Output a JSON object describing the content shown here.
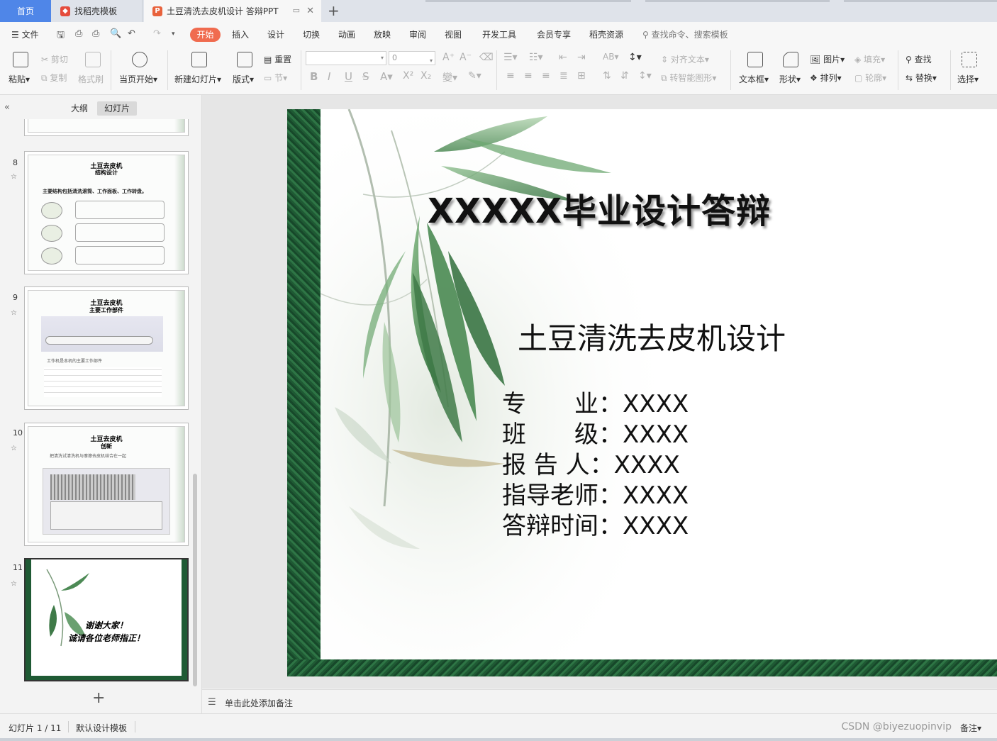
{
  "tabs": {
    "home": "首页",
    "template_tab": "找稻壳模板",
    "doc_tab": "土豆清洗去皮机设计 答辩PPT"
  },
  "menu": {
    "file": "文件",
    "items": [
      "开始",
      "插入",
      "设计",
      "切换",
      "动画",
      "放映",
      "审阅",
      "视图",
      "开发工具",
      "会员专享",
      "稻壳资源"
    ],
    "search": "查找命令、搜索模板"
  },
  "ribbon": {
    "paste": "粘贴",
    "cut": "剪切",
    "copy": "复制",
    "format_painter": "格式刷",
    "from_start": "当页开始",
    "new_slide": "新建幻灯片",
    "layout": "版式",
    "reset": "重置",
    "section": "节",
    "font_size": "0",
    "align_text": "对齐文本",
    "smart_art": "转智能图形",
    "text_box": "文本框",
    "shape": "形状",
    "picture": "图片",
    "arrange": "排列",
    "fill": "填充",
    "outline": "轮廓",
    "find": "查找",
    "replace": "替换",
    "select": "选择"
  },
  "left_pane": {
    "tab_outline": "大纲",
    "tab_slides": "幻灯片",
    "slides": [
      {
        "num": "8",
        "title": "土豆去皮机",
        "sub": "结构设计",
        "text": "主要结构包括清洗滚筒、工作面板、工作转盘。"
      },
      {
        "num": "9",
        "title": "土豆去皮机",
        "sub": "主要工作部件",
        "text": "工作机是本机的主要工作部件"
      },
      {
        "num": "10",
        "title": "土豆去皮机",
        "sub": "创新",
        "text": "把清洗试清洗机与摩擦去皮机结合在一起"
      },
      {
        "num": "11",
        "title": "谢谢大家！",
        "sub": "诚请各位老师指正！",
        "text": ""
      }
    ]
  },
  "slide": {
    "title": "XXXXX毕业设计答辩",
    "subtitle": "土豆清洗去皮机设计",
    "info": [
      {
        "label": "专　　业：",
        "value": "XXXX"
      },
      {
        "label": "班　　级：",
        "value": "XXXX"
      },
      {
        "label": "报 告 人：",
        "value": "XXXX"
      },
      {
        "label": "指导老师：",
        "value": "XXXX"
      },
      {
        "label": "答辩时间：",
        "value": "XXXX"
      }
    ]
  },
  "notes": {
    "placeholder": "单击此处添加备注"
  },
  "status": {
    "slide_count": "幻灯片 1 / 11",
    "template": "默认设计模板",
    "watermark": "CSDN @biyezuopinvip",
    "notes_btn": "备注"
  },
  "colors": {
    "accent": "#f06b4f",
    "home_tab": "#4f86e8",
    "marble": "#1f5a34"
  }
}
